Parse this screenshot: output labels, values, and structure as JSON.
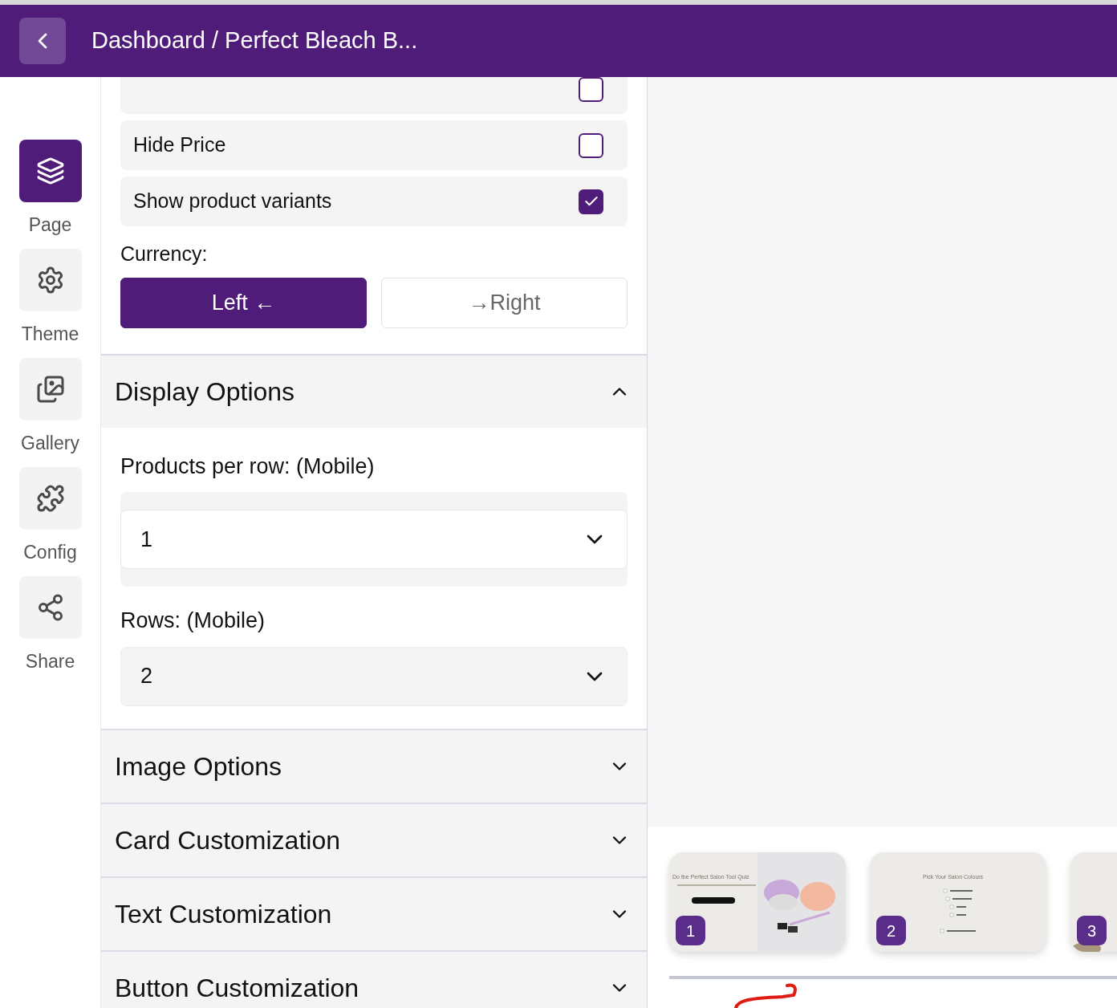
{
  "header": {
    "title": "Dashboard / Perfect Bleach B..."
  },
  "rail": [
    {
      "label": "Page",
      "selected": true
    },
    {
      "label": "Theme",
      "selected": false
    },
    {
      "label": "Gallery",
      "selected": false
    },
    {
      "label": "Config",
      "selected": false
    },
    {
      "label": "Share",
      "selected": false
    }
  ],
  "partial_option": {
    "checked": false
  },
  "options": [
    {
      "label": "Hide Price",
      "checked": false
    },
    {
      "label": "Show product variants",
      "checked": true
    }
  ],
  "currency": {
    "label": "Currency:",
    "buttons": [
      {
        "label": "Left ←",
        "selected": true
      },
      {
        "label": "→Right",
        "selected": false
      }
    ]
  },
  "display_options": {
    "title": "Display Options",
    "expanded": true,
    "fields": [
      {
        "label": "Products per row: (Mobile)",
        "value": "1",
        "kind": "raised"
      },
      {
        "label": "Rows: (Mobile)",
        "value": "2",
        "kind": "flat"
      }
    ]
  },
  "sections": [
    {
      "title": "Image Options",
      "expanded": false
    },
    {
      "title": "Card Customization",
      "expanded": false
    },
    {
      "title": "Text Customization",
      "expanded": false
    },
    {
      "title": "Button Customization",
      "expanded": false
    }
  ],
  "slides": [
    {
      "number": "1",
      "kind": "picture",
      "title": "Do the Perfect Salon Tool Quiz"
    },
    {
      "number": "2",
      "kind": "picture",
      "title": "Pick Your Salon Colours"
    },
    {
      "number": "3",
      "kind": "picture"
    }
  ]
}
